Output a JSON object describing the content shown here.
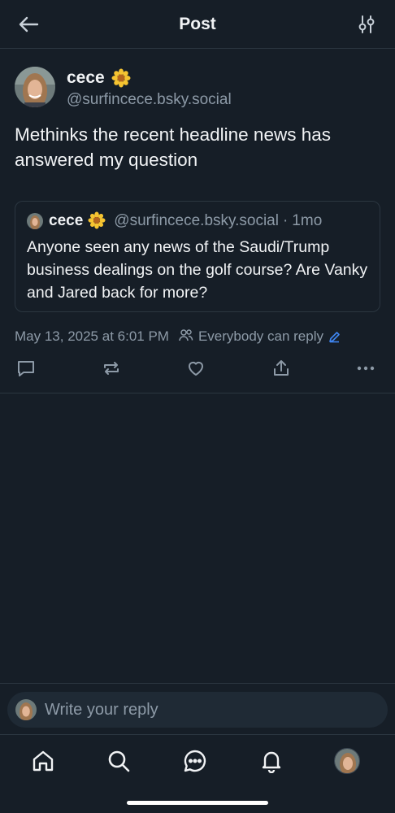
{
  "header": {
    "title": "Post"
  },
  "post": {
    "author_name": "cece",
    "author_handle": "@surfincece.bsky.social",
    "text": "Methinks the recent headline news has answered my question",
    "quote": {
      "author_name": "cece",
      "author_handle": "@surfincece.bsky.social",
      "separator": "·",
      "time": "1mo",
      "text": "Anyone seen any news of the Saudi/Trump business dealings on the golf course? Are Vanky and Jared back for more?"
    },
    "timestamp": "May 13, 2025 at 6:01 PM",
    "reply_setting": "Everybody can reply"
  },
  "reply": {
    "placeholder": "Write your reply"
  },
  "colors": {
    "background": "#161e27",
    "text": "#f1f3f5",
    "muted": "#8d9aa7",
    "accent": "#3f86f2",
    "divider": "#2b3640"
  },
  "icons": [
    "back-arrow-icon",
    "filter-icon",
    "flower-emoji-icon",
    "people-icon",
    "pencil-icon",
    "comment-icon",
    "repost-icon",
    "heart-icon",
    "share-icon",
    "more-icon",
    "home-icon",
    "search-icon",
    "chat-icon",
    "bell-icon"
  ]
}
